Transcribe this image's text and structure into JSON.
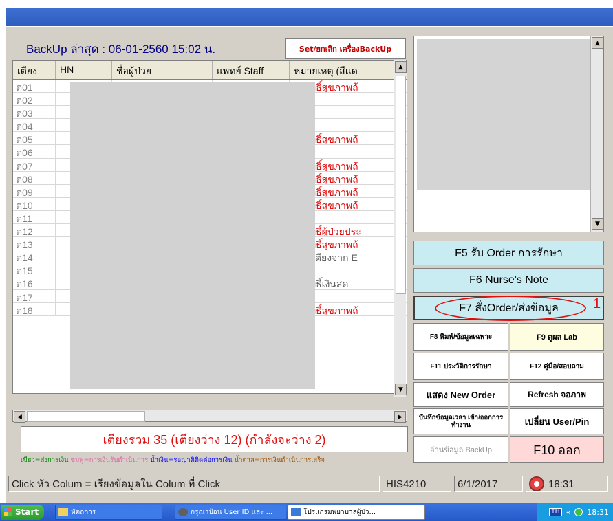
{
  "backup": {
    "label": "BackUp ล่าสุด : 06-01-2560 15:02 น.",
    "set_button": "Set/ยกเลิก เครื่องBackUp"
  },
  "grid": {
    "columns": [
      "เตียง",
      "HN",
      "ชื่อผู้ป่วย",
      "แพทย์ Staff",
      "หมายเหตุ (สีแด"
    ],
    "rows": [
      {
        "bed": "ต01",
        "note": "ใช้สิทธิ์สุขภาพถ้"
      },
      {
        "bed": "ต02",
        "note": ""
      },
      {
        "bed": "ต03",
        "note": ""
      },
      {
        "bed": "ต04",
        "note": ""
      },
      {
        "bed": "ต05",
        "note": "ใช้สิทธิ์สุขภาพถ้"
      },
      {
        "bed": "ต06",
        "note": ""
      },
      {
        "bed": "ต07",
        "note": "ใช้สิทธิ์สุขภาพถ้"
      },
      {
        "bed": "ต08",
        "note": "ใช้สิทธิ์สุขภาพถ้"
      },
      {
        "bed": "ต09",
        "note": "ใช้สิทธิ์สุขภาพถ้"
      },
      {
        "bed": "ต10",
        "note": "ใช้สิทธิ์สุขภาพถ้"
      },
      {
        "bed": "ต11",
        "note": ""
      },
      {
        "bed": "ต12",
        "note": "ใช้สิทธิ์ผู้ป่วยประ"
      },
      {
        "bed": "ต13",
        "note": "ใช้สิทธิ์สุขภาพถ้"
      },
      {
        "bed": "ต14",
        "note": "(จองเตียงจาก E"
      },
      {
        "bed": "ต15",
        "note": ""
      },
      {
        "bed": "ต16",
        "note": "ใช้สิทธิ์เงินสด"
      },
      {
        "bed": "ต17",
        "note": ""
      },
      {
        "bed": "ต18",
        "note": "ใช้สิทธิ์สุขภาพถ้"
      }
    ]
  },
  "summary": "เตียงรวม 35 (เตียงว่าง 12) (กำลังจะว่าง 2)",
  "legend": {
    "green": "เขียว=ส่งการเงิน",
    "pink": "ชมพู=การเงินรับดำเนินการ",
    "blue": "น้ำเงิน=รอญาติติดต่อการเงิน",
    "brown": "น้ำตาล=การเงินดำเนินการเสร็จ"
  },
  "buttons": {
    "f5": "F5 รับ Order การรักษา",
    "f6": "F6 Nurse's Note",
    "f7": "F7 สั่งOrder/ส่งข้อมูล",
    "f8": "F8 พิมพ์/ข้อมูลเฉพาะ",
    "f9": "F9 ดูผล Lab",
    "f11": "F11 ประวัติการรักษา",
    "f12": "F12 คู่มือ/สอบถาม",
    "new_order": "แสดง New Order",
    "refresh": "Refresh จอภาพ",
    "save_time": "บันทึกข้อมูลเวลา เข้า/ออกการทำงาน",
    "change_user": "เปลี่ยน User/Pin",
    "read_backup": "อ่านข้อมูล BackUp",
    "f10": "F10 ออก"
  },
  "annotation": "1",
  "statusbar": {
    "hint": "Click หัว Colum = เรียงข้อมูลใน Colum ที่ Click",
    "station": "HIS4210",
    "date": "6/1/2017",
    "time": "18:31"
  },
  "taskbar": {
    "start": "Start",
    "folder": "หัตถการ",
    "login": "กรุณาป้อน User ID และ ...",
    "program": "โปรแกรมพยาบาลผู้ป่ว...",
    "lang": "TH",
    "chevron": "«",
    "time": "18:31"
  }
}
